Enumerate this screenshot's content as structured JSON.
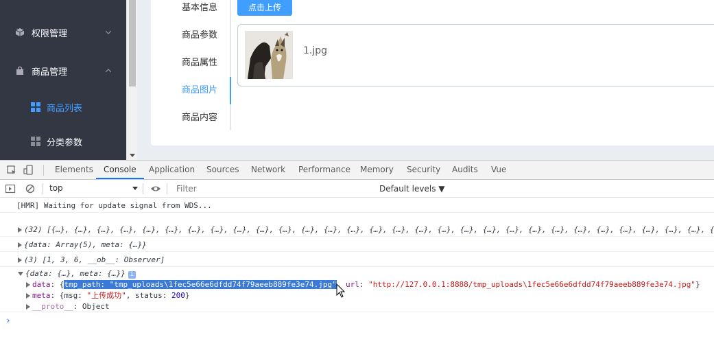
{
  "sidebar": {
    "items": [
      {
        "label": "权限管理",
        "icon": "cube-icon"
      },
      {
        "label": "商品管理",
        "icon": "bag-icon"
      }
    ],
    "subitems": [
      {
        "label": "商品列表",
        "active": true
      },
      {
        "label": "分类参数",
        "active": false
      }
    ]
  },
  "card": {
    "tabs": [
      "基本信息",
      "商品参数",
      "商品属性",
      "商品图片",
      "商品内容"
    ],
    "active_tab": "商品图片",
    "upload_label": "点击上传",
    "file_name": "1.jpg"
  },
  "devtools": {
    "tabs": [
      "Elements",
      "Console",
      "Application",
      "Sources",
      "Network",
      "Performance",
      "Memory",
      "Security",
      "Audits",
      "Vue"
    ],
    "active_tab": "Console",
    "context": "top",
    "filter_placeholder": "Filter",
    "levels": "Default levels ▼",
    "accent": "#1a73e8"
  },
  "console": {
    "hmr": "[HMR] Waiting for update signal from WDS...",
    "line_array": "(32) [{…}, {…}, {…}, {…}, {…}, {…}, {…}, {…}, {…}, {…}, {…}, {…}, {…}, {…}, {…}, {…}, {…}, {…}, {…}, {…}, {…}, {…}, {…}, {…}, {…}, {…}, {…}, {…}, {…}, {…}, {…}, {…}]",
    "line_data_meta": "{data: Array(5), meta: {…}}",
    "line_observer": "(3) [1, 3, 6, __ob__: Observer]",
    "line_expanded": "{data: {…}, meta: {…}}",
    "info_badge": "i",
    "data_key": "data",
    "data_open": ": {",
    "tmp_path": "tmp_path: \"tmp_uploads\\1fec5e66e6dfdd74f79aeeb889fe3e74.jpg\"",
    "url_key": "url",
    "url_value": "\"http://127.0.0.1:8888/tmp_uploads\\1fec5e66e6dfdd74f79aeeb889fe3e74.jpg\"",
    "meta_key": "meta",
    "meta_open": ": {msg: ",
    "meta_msg": "\"上传成功\"",
    "meta_status_key": ", status: ",
    "meta_status": "200",
    "proto_key": "__proto__",
    "proto_value": ": Object",
    "prompt": "›"
  }
}
